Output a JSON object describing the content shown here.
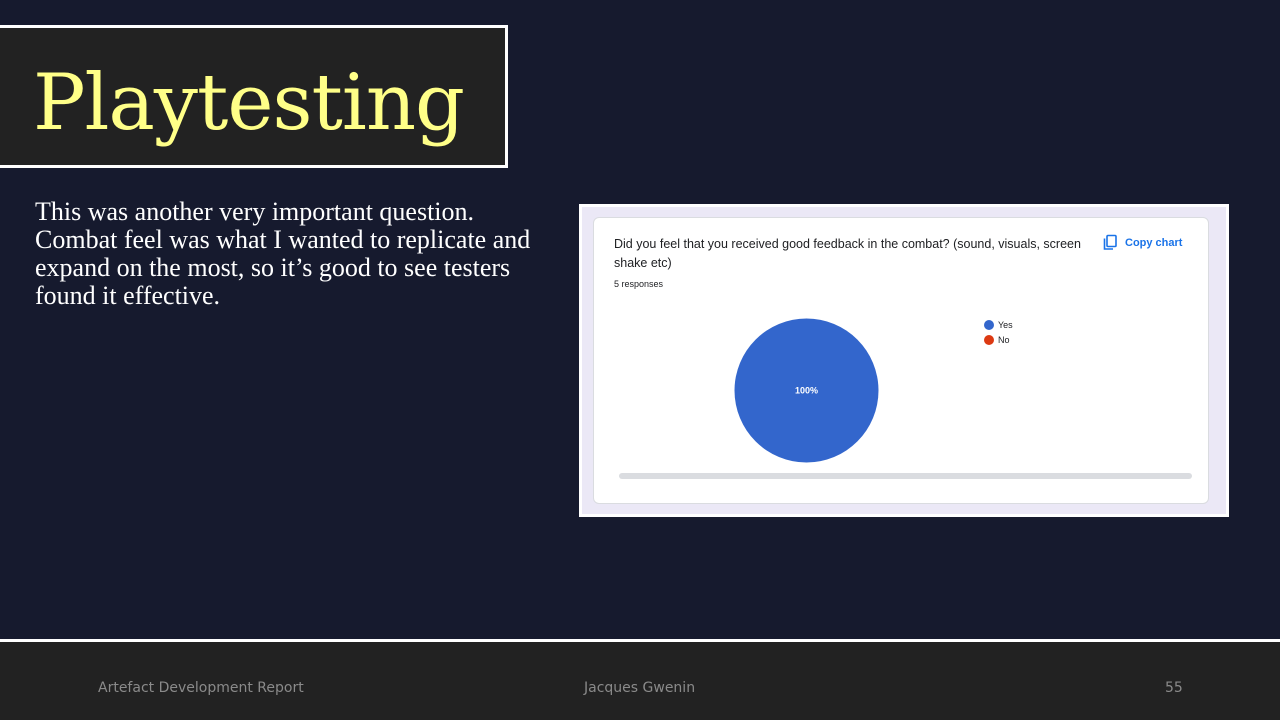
{
  "slide": {
    "title": "Playtesting",
    "body": "This was another very important question. Combat feel was what I wanted to replicate and expand on the most, so it’s good to see testers found it effective."
  },
  "form_card": {
    "question": "Did you feel that you received good feedback in the combat? (sound, visuals, screen shake etc)",
    "responses": "5 responses",
    "copy_label": "Copy chart",
    "copy_icon": "copy-icon",
    "accent_color": "#1a73e8"
  },
  "chart_data": {
    "type": "pie",
    "categories": [
      "Yes",
      "No"
    ],
    "values": [
      100,
      0
    ],
    "colors": [
      "#3366cc",
      "#dc3912"
    ],
    "data_labels": [
      "100%",
      ""
    ],
    "legend_position": "right"
  },
  "footer": {
    "left": "Artefact Development Report",
    "center": "Jacques Gwenin",
    "right": "55"
  }
}
